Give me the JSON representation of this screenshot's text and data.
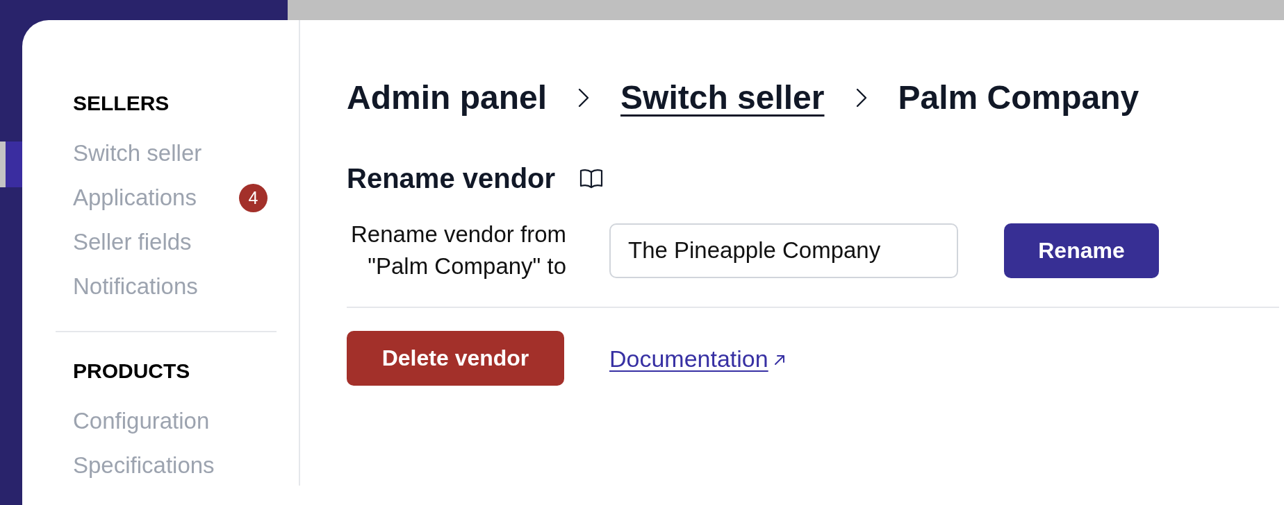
{
  "sidebar": {
    "sections": [
      {
        "heading": "SELLERS",
        "items": [
          {
            "label": "Switch seller"
          },
          {
            "label": "Applications",
            "badge": "4"
          },
          {
            "label": "Seller fields"
          },
          {
            "label": "Notifications"
          }
        ]
      },
      {
        "heading": "PRODUCTS",
        "items": [
          {
            "label": "Configuration"
          },
          {
            "label": "Specifications"
          }
        ]
      }
    ]
  },
  "breadcrumb": [
    {
      "label": "Admin panel",
      "kind": "text"
    },
    {
      "label": "Switch seller",
      "kind": "link"
    },
    {
      "label": "Palm Company",
      "kind": "text"
    }
  ],
  "rename_vendor": {
    "title": "Rename vendor",
    "field_label": "Rename vendor from \"Palm Company\" to",
    "value": "The Pineapple Company",
    "button": "Rename"
  },
  "actions": {
    "delete_button": "Delete vendor",
    "documentation_link": "Documentation"
  }
}
